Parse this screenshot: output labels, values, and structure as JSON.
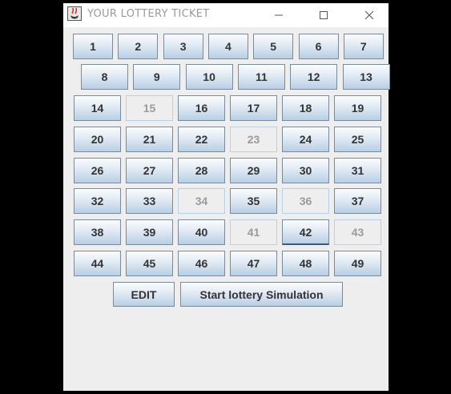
{
  "window": {
    "title": "YOUR  LOTTERY  TICKET",
    "icon": "java-cup-icon",
    "controls": [
      "minimize-icon",
      "maximize-icon",
      "close-icon"
    ]
  },
  "numbers": [
    {
      "label": "1",
      "enabled": true
    },
    {
      "label": "2",
      "enabled": true
    },
    {
      "label": "3",
      "enabled": true
    },
    {
      "label": "4",
      "enabled": true
    },
    {
      "label": "5",
      "enabled": true
    },
    {
      "label": "6",
      "enabled": true
    },
    {
      "label": "7",
      "enabled": true
    },
    {
      "label": "8",
      "enabled": true
    },
    {
      "label": "9",
      "enabled": true
    },
    {
      "label": "10",
      "enabled": true
    },
    {
      "label": "11",
      "enabled": true
    },
    {
      "label": "12",
      "enabled": true
    },
    {
      "label": "13",
      "enabled": true
    },
    {
      "label": "14",
      "enabled": true
    },
    {
      "label": "15",
      "enabled": false
    },
    {
      "label": "16",
      "enabled": true
    },
    {
      "label": "17",
      "enabled": true
    },
    {
      "label": "18",
      "enabled": true
    },
    {
      "label": "19",
      "enabled": true
    },
    {
      "label": "20",
      "enabled": true
    },
    {
      "label": "21",
      "enabled": true
    },
    {
      "label": "22",
      "enabled": true
    },
    {
      "label": "23",
      "enabled": false
    },
    {
      "label": "24",
      "enabled": true
    },
    {
      "label": "25",
      "enabled": true
    },
    {
      "label": "26",
      "enabled": true
    },
    {
      "label": "27",
      "enabled": true
    },
    {
      "label": "28",
      "enabled": true
    },
    {
      "label": "29",
      "enabled": true
    },
    {
      "label": "30",
      "enabled": true
    },
    {
      "label": "31",
      "enabled": true
    },
    {
      "label": "32",
      "enabled": true
    },
    {
      "label": "33",
      "enabled": true
    },
    {
      "label": "34",
      "enabled": false
    },
    {
      "label": "35",
      "enabled": true
    },
    {
      "label": "36",
      "enabled": false
    },
    {
      "label": "37",
      "enabled": true
    },
    {
      "label": "38",
      "enabled": true
    },
    {
      "label": "39",
      "enabled": true
    },
    {
      "label": "40",
      "enabled": true
    },
    {
      "label": "41",
      "enabled": false
    },
    {
      "label": "42",
      "enabled": true,
      "selected": true
    },
    {
      "label": "43",
      "enabled": false
    },
    {
      "label": "44",
      "enabled": true
    },
    {
      "label": "45",
      "enabled": true
    },
    {
      "label": "46",
      "enabled": true
    },
    {
      "label": "47",
      "enabled": true
    },
    {
      "label": "48",
      "enabled": true
    },
    {
      "label": "49",
      "enabled": true
    }
  ],
  "actions": {
    "edit_label": "EDIT",
    "start_label": "Start lottery Simulation"
  },
  "colors": {
    "background": "#eeeeee",
    "button_top": "#fbfcfd",
    "button_bottom": "#b8cfe5",
    "button_text": "#333333",
    "disabled_text": "#9a9a9a"
  }
}
